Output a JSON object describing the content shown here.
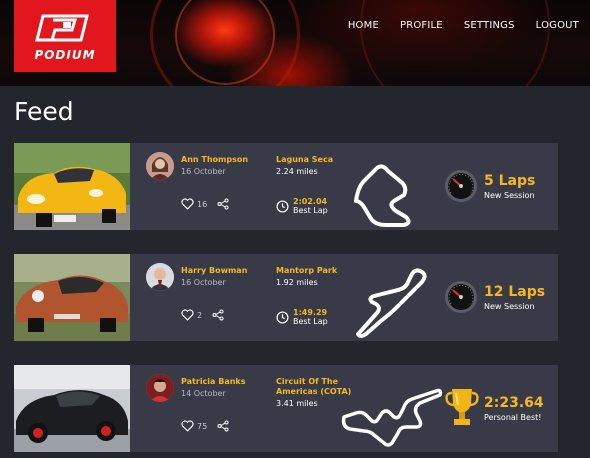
{
  "brand": {
    "name": "PODIUM",
    "color": "#e2161d"
  },
  "nav": [
    "HOME",
    "PROFILE",
    "SETTINGS",
    "LOGOUT"
  ],
  "page_title": "Feed",
  "accent_color": "#f5b820",
  "feed": [
    {
      "user": "Ann Thompson",
      "date": "16 October",
      "likes": "16",
      "track": "Laguna Seca",
      "distance": "2.24 miles",
      "best_lap_time": "2:02.04",
      "best_lap_label": "Best Lap",
      "metric_value": "5 Laps",
      "metric_label": "New Session",
      "metric_icon": "speedometer-icon"
    },
    {
      "user": "Harry Bowman",
      "date": "16 October",
      "likes": "2",
      "track": "Mantorp Park",
      "distance": "1.92 miles",
      "best_lap_time": "1:49.29",
      "best_lap_label": "Best Lap",
      "metric_value": "12 Laps",
      "metric_label": "New Session",
      "metric_icon": "speedometer-icon"
    },
    {
      "user": "Patricia Banks",
      "date": "14 October",
      "likes": "75",
      "track": "Circuit Of The Americas (COTA)",
      "distance": "3.41 miles",
      "metric_value": "2:23.64",
      "metric_label": "Personal Best!",
      "metric_icon": "trophy-icon"
    }
  ]
}
